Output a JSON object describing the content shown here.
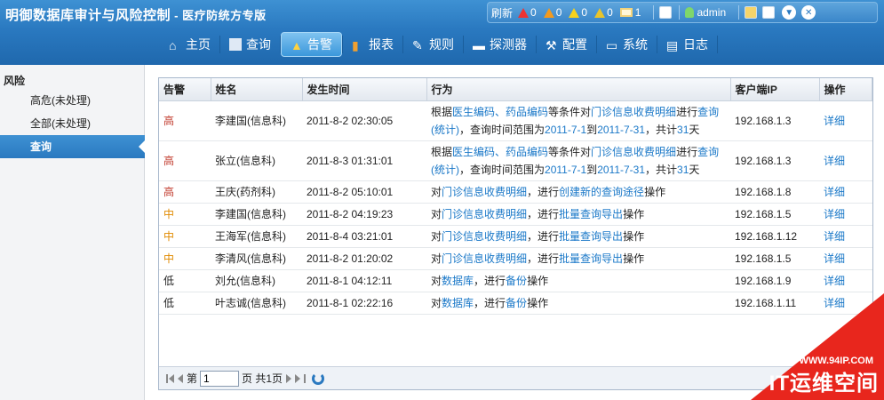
{
  "app": {
    "title": "明御数据库审计与风险控制",
    "subtitle": " - 医疗防统方专版"
  },
  "status": {
    "refresh_label": "刷新",
    "counts": [
      "0",
      "0",
      "0",
      "0",
      "1"
    ],
    "user": "admin",
    "colors": {
      "red": "#e33333",
      "orange": "#f39a1d",
      "yellow": "#f7d21d"
    }
  },
  "nav": [
    {
      "label": "主页",
      "icon": "home-icon"
    },
    {
      "label": "查询",
      "icon": "list-icon"
    },
    {
      "label": "告警",
      "icon": "warning-icon"
    },
    {
      "label": "报表",
      "icon": "bar-chart-icon"
    },
    {
      "label": "规则",
      "icon": "rule-icon"
    },
    {
      "label": "探测器",
      "icon": "probe-icon"
    },
    {
      "label": "配置",
      "icon": "tools-icon"
    },
    {
      "label": "系统",
      "icon": "monitor-icon"
    },
    {
      "label": "日志",
      "icon": "document-icon"
    }
  ],
  "sidebar": {
    "heading": "风险",
    "items": [
      "高危(未处理)",
      "全部(未处理)",
      "查询"
    ]
  },
  "table": {
    "headers": [
      "告警",
      "姓名",
      "发生时间",
      "行为",
      "客户端IP",
      "操作"
    ],
    "rows": [
      {
        "level": "高",
        "name": "李建国(信息科)",
        "time": "2011-8-2 02:30:05",
        "ip": "192.168.1.3",
        "op": "详细"
      },
      {
        "level": "高",
        "name": "张立(信息科)",
        "time": "2011-8-3 01:31:01",
        "ip": "192.168.1.3",
        "op": "详细"
      },
      {
        "level": "高",
        "name": "王庆(药剂科)",
        "time": "2011-8-2 05:10:01",
        "ip": "192.168.1.8",
        "op": "详细"
      },
      {
        "level": "中",
        "name": "李建国(信息科)",
        "time": "2011-8-2 04:19:23",
        "ip": "192.168.1.5",
        "op": "详细"
      },
      {
        "level": "中",
        "name": "王海军(信息科)",
        "time": "2011-8-4 03:21:01",
        "ip": "192.168.1.12",
        "op": "详细"
      },
      {
        "level": "中",
        "name": "李清风(信息科)",
        "time": "2011-8-2 01:20:02",
        "ip": "192.168.1.5",
        "op": "详细"
      },
      {
        "level": "低",
        "name": "刘允(信息科)",
        "time": "2011-8-1 04:12:11",
        "ip": "192.168.1.9",
        "op": "详细"
      },
      {
        "level": "低",
        "name": "叶志诚(信息科)",
        "time": "2011-8-1 02:22:16",
        "ip": "192.168.1.11",
        "op": "详细"
      }
    ],
    "behaviors": {
      "r0": {
        "a": "根据",
        "b": "医生编码、药品编码",
        "c": "等条件对",
        "d": "门诊信息收费明细",
        "e": "进行",
        "f": "查询(统计)",
        "g": "，查询时间范围为",
        "h": "2011-7-1",
        "i": "到",
        "j": "2011-7-31",
        "k": "，共计",
        "l": "31",
        "m": "天"
      },
      "r1": {
        "a": "根据",
        "b": "医生编码、药品编码",
        "c": "等条件对",
        "d": "门诊信息收费明细",
        "e": "进行",
        "f": "查询(统计)",
        "g": "，查询时间范围为",
        "h": "2011-7-1",
        "i": "到",
        "j": "2011-7-31",
        "k": "，共计",
        "l": "31",
        "m": "天"
      },
      "r2": {
        "a": "对",
        "b": "门诊信息收费明细",
        "c": "，进行",
        "d": "创建新的查询途径",
        "e": "操作"
      },
      "r3": {
        "a": "对",
        "b": "门诊信息收费明细",
        "c": "，进行",
        "d": "批量查询导出",
        "e": "操作"
      },
      "r4": {
        "a": "对",
        "b": "门诊信息收费明细",
        "c": "，进行",
        "d": "批量查询导出",
        "e": "操作"
      },
      "r5": {
        "a": "对",
        "b": "门诊信息收费明细",
        "c": "，进行",
        "d": "批量查询导出",
        "e": "操作"
      },
      "r6": {
        "a": "对",
        "b": "数据库",
        "c": "，进行",
        "d": "备份",
        "e": "操作"
      },
      "r7": {
        "a": "对",
        "b": "数据库",
        "c": "，进行",
        "d": "备份",
        "e": "操作"
      }
    }
  },
  "pager": {
    "prefix": "第",
    "page_value": "1",
    "suffix": "页 共1页"
  },
  "watermark": {
    "url": "WWW.94IP.COM",
    "text": "IT运维空间"
  }
}
